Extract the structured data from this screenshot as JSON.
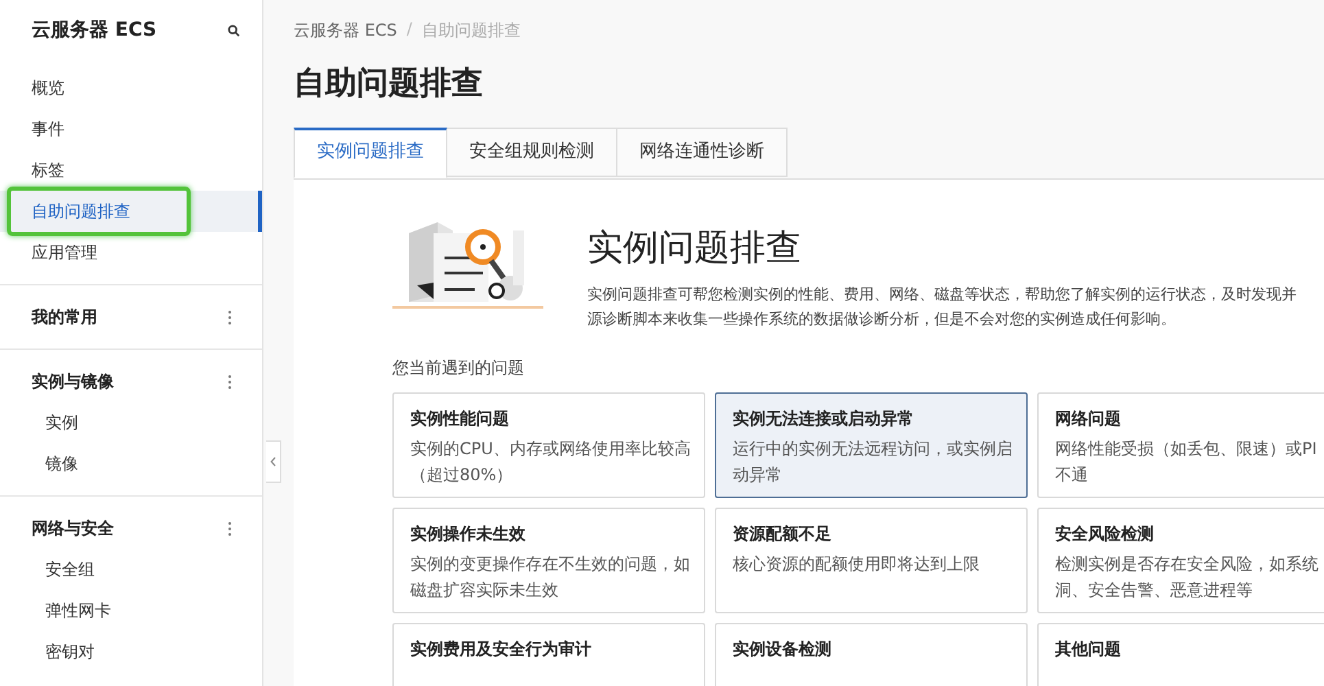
{
  "sidebar": {
    "title": "云服务器 ECS",
    "items": [
      {
        "label": "概览",
        "selected": false
      },
      {
        "label": "事件",
        "selected": false
      },
      {
        "label": "标签",
        "selected": false
      },
      {
        "label": "自助问题排查",
        "selected": true
      },
      {
        "label": "应用管理",
        "selected": false
      }
    ],
    "groups": [
      {
        "title": "我的常用"
      },
      {
        "title": "实例与镜像",
        "items": [
          {
            "label": "实例",
            "selected": false
          },
          {
            "label": "镜像",
            "selected": false
          }
        ]
      },
      {
        "title": "网络与安全",
        "items": [
          {
            "label": "安全组",
            "selected": false
          },
          {
            "label": "弹性网卡",
            "selected": false
          },
          {
            "label": "密钥对",
            "selected": false
          }
        ]
      }
    ]
  },
  "breadcrumb": {
    "items": [
      "云服务器 ECS",
      "自助问题排查"
    ],
    "separator": "/"
  },
  "page_title": "自助问题排查",
  "tabs": [
    {
      "label": "实例问题排查",
      "selected": true
    },
    {
      "label": "安全组规则检测",
      "selected": false
    },
    {
      "label": "网络连通性诊断",
      "selected": false
    }
  ],
  "intro": {
    "title": "实例问题排查",
    "description_lines": [
      "实例问题排查可帮您检测实例的性能、费用、网络、磁盘等状态，帮助您了解实例的运行状态，及时发现并",
      "源诊断脚本来收集一些操作系统的数据做诊断分析，但是不会对您的实例造成任何影响。"
    ]
  },
  "section_label": "您当前遇到的问题",
  "cards": [
    {
      "title": "实例性能问题",
      "description_lines": [
        "实例的CPU、内存或网络使用率比较高",
        "（超过80%）"
      ],
      "selected": false
    },
    {
      "title": "实例无法连接或启动异常",
      "description_lines": [
        "运行中的实例无法远程访问，或实例启",
        "动异常"
      ],
      "selected": true
    },
    {
      "title": "网络问题",
      "description_lines": [
        "网络性能受损（如丢包、限速）或PI",
        "不通"
      ],
      "selected": false
    },
    {
      "title": "实例操作未生效",
      "description_lines": [
        "实例的变更操作存在不生效的问题，如",
        "磁盘扩容实际未生效"
      ],
      "selected": false
    },
    {
      "title": "资源配额不足",
      "description_lines": [
        "核心资源的配额使用即将达到上限"
      ],
      "selected": false
    },
    {
      "title": "安全风险检测",
      "description_lines": [
        "检测实例是否存在安全风险，如系统",
        "洞、安全告警、恶意进程等"
      ],
      "selected": false
    },
    {
      "title": "实例费用及安全行为审计",
      "selected": false
    },
    {
      "title": "实例设备检测",
      "selected": false
    },
    {
      "title": "其他问题",
      "selected": false
    }
  ]
}
